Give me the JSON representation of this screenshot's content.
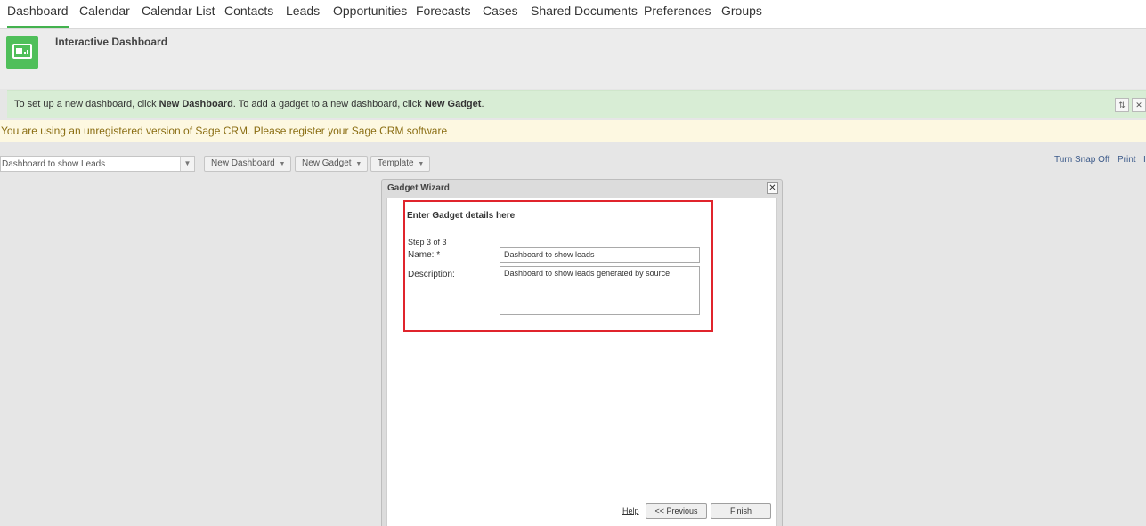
{
  "nav": {
    "tabs": [
      {
        "label": "Dashboard"
      },
      {
        "label": "Calendar"
      },
      {
        "label": "Calendar List"
      },
      {
        "label": "Contacts"
      },
      {
        "label": "Leads"
      },
      {
        "label": "Opportunities"
      },
      {
        "label": "Forecasts"
      },
      {
        "label": "Cases"
      },
      {
        "label": "Shared Documents"
      },
      {
        "label": "Preferences"
      },
      {
        "label": "Groups"
      }
    ],
    "active_tab": "Dashboard"
  },
  "header": {
    "title": "Interactive Dashboard",
    "icon": "dashboard-icon"
  },
  "infobar": {
    "text_1": "To set up a new dashboard, click ",
    "bold_1": "New Dashboard",
    "text_2": ". To add a gadget to a new dashboard, click ",
    "bold_2": "New Gadget",
    "text_3": ".",
    "icons": [
      "collapse-icon",
      "close-icon"
    ]
  },
  "warning": {
    "text": "You are using an unregistered version of Sage CRM. Please register your Sage CRM software"
  },
  "toolbar": {
    "dashboard_select_value": "Dashboard to show Leads",
    "new_dashboard": "New Dashboard",
    "new_gadget": "New Gadget",
    "template": "Template",
    "turn_snap_off": "Turn Snap Off",
    "print": "Print",
    "trailing_link": "I"
  },
  "dialog": {
    "title": "Gadget Wizard",
    "close": "✕",
    "heading": "Enter Gadget details here",
    "step": "Step 3 of 3",
    "name_label": "Name: *",
    "name_value": "Dashboard to show leads",
    "description_label": "Description:",
    "description_value": "Dashboard to show leads generated by source",
    "help": "Help",
    "previous": "<< Previous",
    "finish": "Finish"
  },
  "colors": {
    "accent_green": "#43b24e",
    "info_bg": "#d8edd5",
    "warning_bg": "#fdf8e1",
    "warning_text": "#8a6d12",
    "highlight": "#e0242c"
  }
}
